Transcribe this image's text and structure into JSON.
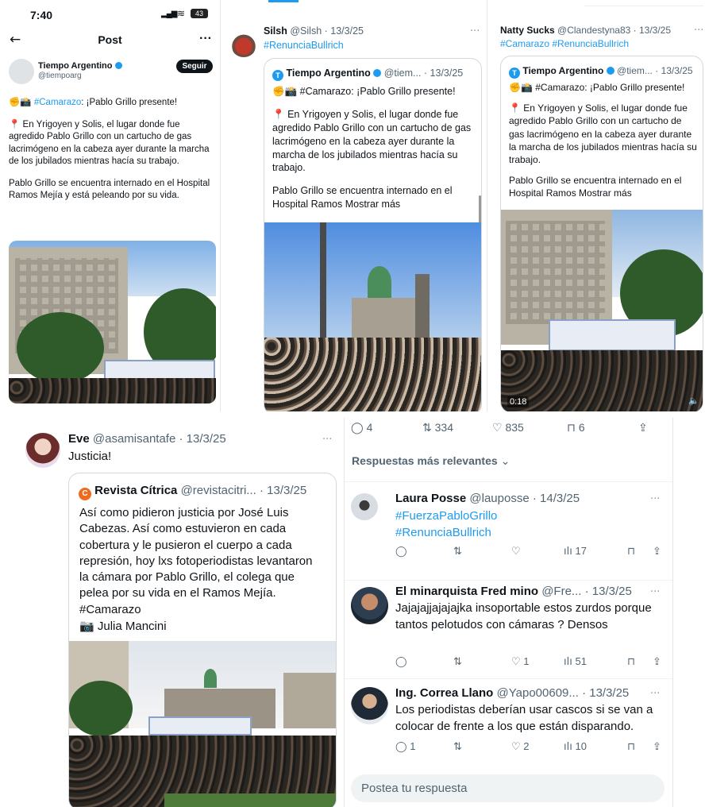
{
  "panel1": {
    "status_time": "7:40",
    "battery": "43",
    "back_icon": "arrow-left-icon",
    "header_title": "Post",
    "author_name": "Tiempo Argentino",
    "author_handle": "@tiempoarg",
    "follow_label": "Seguir",
    "line1_hashtag": "#Camarazo",
    "line1_rest": ": ¡Pablo Grillo presente!",
    "para1": "En Yrigoyen y Solis, el lugar donde fue agredido Pablo Grillo con un cartucho de gas lacrimógeno en la cabeza ayer durante la marcha de los jubilados mientras hacía su trabajo.",
    "para2": "Pablo Grillo se encuentra internado en el Hospital Ramos Mejía y está peleando por su vida."
  },
  "panel2": {
    "name": "Silsh",
    "handle": "@Silsh",
    "date": "· 13/3/25",
    "hashtag": "#RenunciaBullrich",
    "q_name": "Tiempo Argentino",
    "q_handle": "@tiem...",
    "q_date": "· 13/3/25",
    "q_line1": "#Camarazo: ¡Pablo Grillo presente!",
    "q_para1": "En Yrigoyen y Solis, el lugar donde fue agredido Pablo Grillo con un cartucho de gas lacrimógeno en la cabeza ayer durante la marcha de los jubilados mientras hacía su trabajo.",
    "q_para2": "Pablo Grillo se encuentra internado en el Hospital Ramos Mostrar más"
  },
  "panel3": {
    "name": "Natty Sucks",
    "handle": "@Clandestyna83",
    "date": "· 13/3/25",
    "hashtags": "#Camarazo #RenunciaBullrich",
    "q_name": "Tiempo Argentino",
    "q_handle": "@tiem...",
    "q_date": "· 13/3/25",
    "q_line1": "#Camarazo: ¡Pablo Grillo presente!",
    "q_para1": "En Yrigoyen y Solis, el lugar donde fue agredido Pablo Grillo con un cartucho de gas lacrimógeno en la cabeza ayer durante la marcha de los jubilados mientras hacía su trabajo.",
    "q_para2": "Pablo Grillo se encuentra internado en el Hospital Ramos Mostrar más",
    "video_time": "0:18"
  },
  "panel4": {
    "name": "Eve",
    "handle": "@asamisantafe",
    "date": "· 13/3/25",
    "text": "Justicia!",
    "q_name": "Revista Cítrica",
    "q_handle": "@revistacitri...",
    "q_date": "· 13/3/25",
    "q_text": "Así como pidieron justicia por José Luis Cabezas. Así como estuvieron en cada cobertura y le pusieron el cuerpo a cada represión, hoy lxs fotoperiodistas levantaron la cámara por Pablo Grillo, el colega que pelea por su vida en el Ramos Mejía. #Camarazo",
    "q_credit": "Julia Mancini"
  },
  "panel5": {
    "stats": {
      "replies": "4",
      "reposts": "334",
      "likes": "835",
      "bookmarks": "6"
    },
    "replies_header": "Respuestas más relevantes",
    "replies": [
      {
        "name": "Laura Posse",
        "handle": "@lauposse",
        "date": "· 14/3/25",
        "text": "",
        "tags": [
          "#FuerzaPabloGrillo",
          "#RenunciaBullrich"
        ],
        "reply_count": "",
        "like_count": "",
        "views": "17"
      },
      {
        "name": "El minarquista Fred mino",
        "handle": "@Fre...",
        "date": "· 13/3/25",
        "text": "Jajajajjajajajka  insoportable estos zurdos porque tantos pelotudos con cámaras ? Densos",
        "tags": [],
        "reply_count": "",
        "like_count": "1",
        "views": "51"
      },
      {
        "name": "Ing. Correa Llano",
        "handle": "@Yapo00609...",
        "date": "· 13/3/25",
        "text": "Los periodistas deberían usar cascos si se van a colocar de frente a los que están disparando.",
        "tags": [],
        "reply_count": "1",
        "like_count": "2",
        "views": "10"
      }
    ],
    "reply_placeholder": "Postea tu respuesta"
  },
  "icons": {
    "verified": "verified-badge-icon",
    "more": "more-dots-icon",
    "reply": "reply-icon",
    "repost": "repost-icon",
    "like": "like-icon",
    "views": "views-icon",
    "bookmark": "bookmark-icon",
    "share": "share-icon",
    "pin": "pin-icon",
    "camera": "camera-icon",
    "fist": "fist-icon"
  },
  "colors": {
    "accent": "#1d9bf0",
    "text": "#0f1419",
    "muted": "#536471",
    "follow_bg": "#0f1419"
  }
}
